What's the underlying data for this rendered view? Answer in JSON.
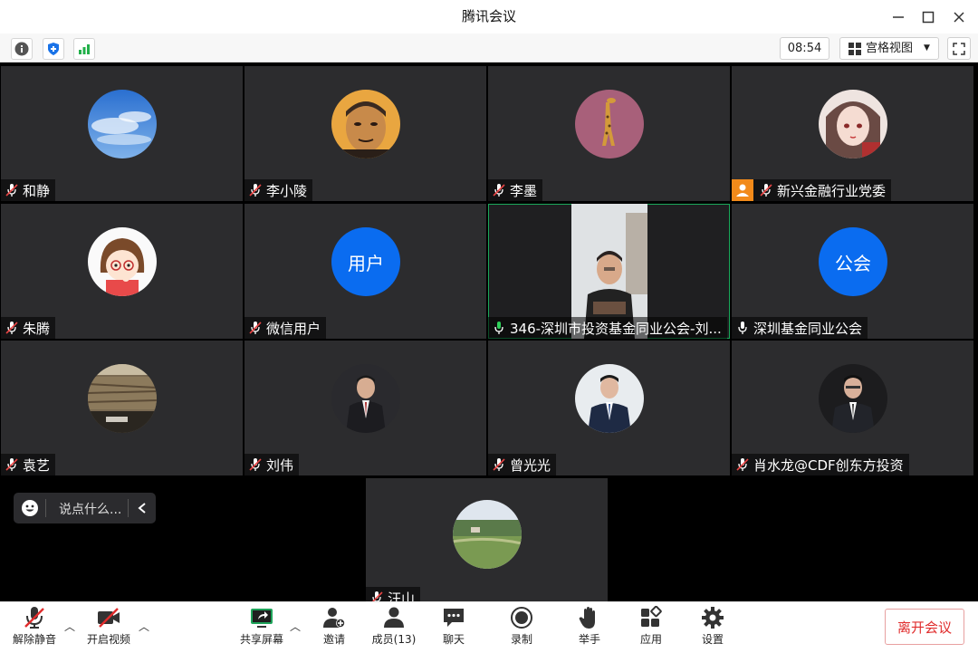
{
  "window": {
    "title": "腾讯会议"
  },
  "toolbar": {
    "time": "08:54",
    "view_label": "宫格视图"
  },
  "participants": [
    {
      "name": "和静",
      "mic": "muted",
      "avatar": "sky"
    },
    {
      "name": "李小陵",
      "mic": "muted",
      "avatar": "face-man"
    },
    {
      "name": "李墨",
      "mic": "muted",
      "avatar": "giraffe"
    },
    {
      "name": "新兴金融行业党委",
      "mic": "muted",
      "avatar": "anime-girl",
      "host_badge": true
    },
    {
      "name": "朱腾",
      "mic": "muted",
      "avatar": "cartoon-girl"
    },
    {
      "name": "微信用户",
      "mic": "muted",
      "avatar_text": "用户"
    },
    {
      "name": "346-深圳市投资基金同业公会-刘...",
      "mic": "speaking",
      "video": true
    },
    {
      "name": "深圳基金同业公会",
      "mic": "on",
      "avatar_text": "公会"
    },
    {
      "name": "袁艺",
      "mic": "muted",
      "avatar": "rock-wall"
    },
    {
      "name": "刘伟",
      "mic": "muted",
      "avatar": "suit-man"
    },
    {
      "name": "曾光光",
      "mic": "muted",
      "avatar": "suit-man-light"
    },
    {
      "name": "肖水龙@CDF创东方投资",
      "mic": "muted",
      "avatar": "suit-man-dark"
    },
    {
      "name": "汪山",
      "mic": "muted",
      "avatar": "golf-course"
    }
  ],
  "chat": {
    "placeholder": "说点什么..."
  },
  "bottombar": {
    "unmute": "解除静音",
    "video": "开启视频",
    "share": "共享屏幕",
    "invite": "邀请",
    "members": "成员(13)",
    "chat": "聊天",
    "record": "录制",
    "raise_hand": "举手",
    "apps": "应用",
    "settings": "设置",
    "leave": "离开会议"
  },
  "colors": {
    "accent_blue": "#0a6cf0",
    "tile_bg": "#2c2c2e",
    "leave_red": "#e02c2c",
    "speaking_green": "#1aa85a"
  }
}
